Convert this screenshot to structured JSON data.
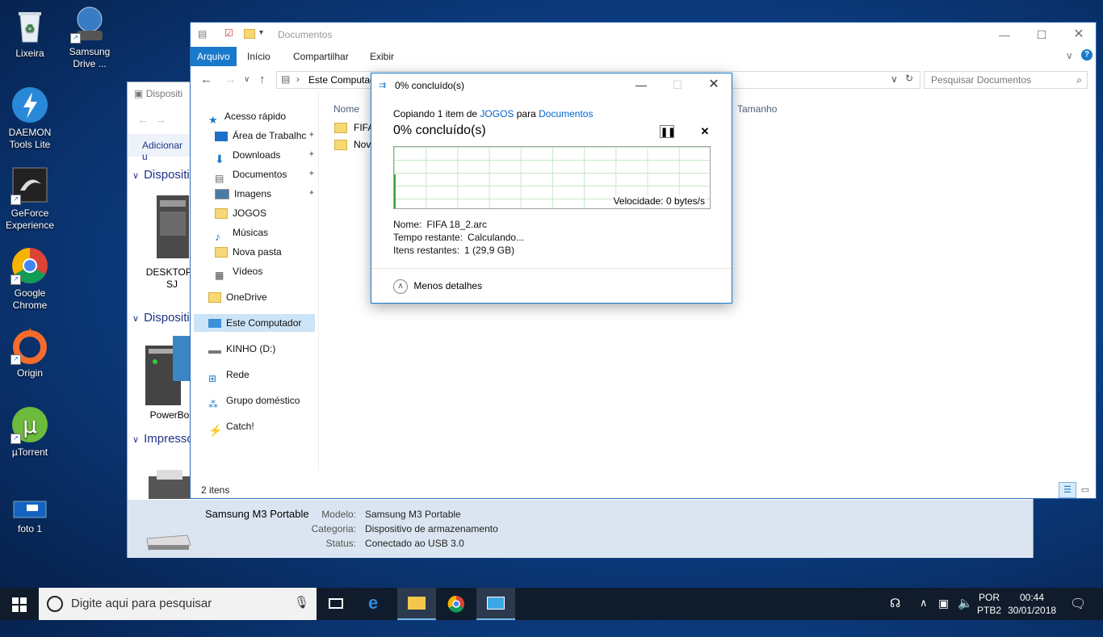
{
  "desktop": {
    "icons": [
      {
        "label": "Lixeira"
      },
      {
        "label": "Samsung\nDrive ..."
      },
      {
        "label": "DAEMON\nTools Lite"
      },
      {
        "label": "GeForce\nExperience"
      },
      {
        "label": "Google\nChrome"
      },
      {
        "label": "Origin"
      },
      {
        "label": "µTorrent"
      },
      {
        "label": "foto 1"
      }
    ]
  },
  "devices_window": {
    "title": "Dispositi",
    "add_label": "Adicionar u",
    "section1": "Dispositi",
    "section2": "Dispositi",
    "section3": "Impresso",
    "device1_label": "DESKTOP-I\nSJ",
    "device2_label": "PowerBox",
    "details": {
      "name": "Samsung M3 Portable",
      "model_label": "Modelo:",
      "model_value": "Samsung M3 Portable",
      "category_label": "Categoria:",
      "category_value": "Dispositivo de armazenamento",
      "status_label": "Status:",
      "status_value": "Conectado ao USB 3.0"
    }
  },
  "explorer": {
    "title": "Documentos",
    "tabs": [
      "Arquivo",
      "Início",
      "Compartilhar",
      "Exibir"
    ],
    "address": "Este Computad",
    "search_placeholder": "Pesquisar Documentos",
    "nav": [
      {
        "label": "Acesso rápido",
        "pinned": false
      },
      {
        "label": "Área de Trabalhc",
        "pinned": true
      },
      {
        "label": "Downloads",
        "pinned": true
      },
      {
        "label": "Documentos",
        "pinned": true
      },
      {
        "label": "Imagens",
        "pinned": true
      },
      {
        "label": "JOGOS",
        "pinned": false
      },
      {
        "label": "Músicas",
        "pinned": false
      },
      {
        "label": "Nova pasta",
        "pinned": false
      },
      {
        "label": "Vídeos",
        "pinned": false
      },
      {
        "label": "OneDrive",
        "pinned": false
      },
      {
        "label": "Este Computador",
        "pinned": false
      },
      {
        "label": "KINHO (D:)",
        "pinned": false
      },
      {
        "label": "Rede",
        "pinned": false
      },
      {
        "label": "Grupo doméstico",
        "pinned": false
      },
      {
        "label": "Catch!",
        "pinned": false
      }
    ],
    "columns": {
      "name": "Nome",
      "size": "Tamanho"
    },
    "files": [
      "FIFA",
      "Nova"
    ],
    "status_count": "2 itens"
  },
  "copy_dialog": {
    "title": "0% concluído(s)",
    "copy_prefix": "Copiando 1 item de ",
    "source": "JOGOS",
    "copy_middle": " para ",
    "destination": "Documentos",
    "progress_text": "0% concluído(s)",
    "progress_percent": 0,
    "speed": "Velocidade: 0 bytes/s",
    "name_label": "Nome:",
    "name_value": "FIFA 18_2.arc",
    "time_label": "Tempo restante:",
    "time_value": "Calculando...",
    "items_label": "Itens restantes:",
    "items_value": "1 (29,9 GB)",
    "less_details": "Menos detalhes"
  },
  "taskbar": {
    "search_placeholder": "Digite aqui para pesquisar",
    "language": "POR",
    "layout": "PTB2",
    "time": "00:44",
    "date": "30/01/2018"
  }
}
